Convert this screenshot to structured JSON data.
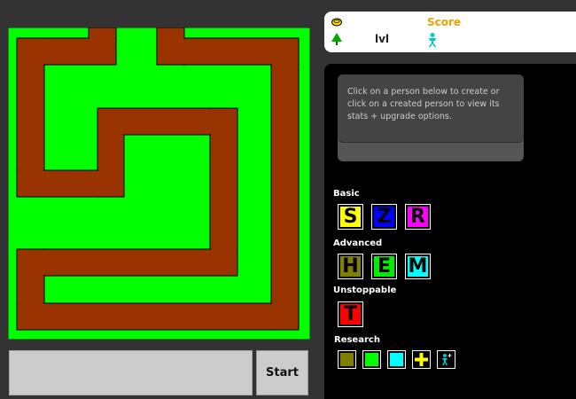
{
  "stats": {
    "score_label": "Score",
    "level_label": "lvl",
    "gold_icon": "coin-icon",
    "tree_icon": "tree-icon",
    "lives_icon": "person-icon"
  },
  "map": {
    "grass_color": "#00ff00",
    "path_color": "#993300"
  },
  "controls": {
    "start_label": "Start",
    "message": ""
  },
  "info": {
    "text": "Click on a person below to create or click on a created person to view its stats + upgrade options."
  },
  "sections": {
    "basic": "Basic",
    "advanced": "Advanced",
    "unstoppable": "Unstoppable",
    "research": "Research"
  },
  "units": {
    "basic": [
      {
        "letter": "S",
        "color": "#ffff00"
      },
      {
        "letter": "Z",
        "color": "#0000ff"
      },
      {
        "letter": "R",
        "color": "#ff00ff"
      }
    ],
    "advanced": [
      {
        "letter": "H",
        "color": "#808000"
      },
      {
        "letter": "E",
        "color": "#00ee00"
      },
      {
        "letter": "M",
        "color": "#00ffff"
      }
    ],
    "unstoppable": [
      {
        "letter": "T",
        "color": "#ff0000"
      }
    ]
  },
  "research": [
    {
      "name": "olive-research",
      "color": "#808000"
    },
    {
      "name": "green-research",
      "color": "#00ff00"
    },
    {
      "name": "cyan-research",
      "color": "#00ffff"
    },
    {
      "name": "plus-research",
      "color": "#ffff00"
    },
    {
      "name": "person-research",
      "color": "#00cccc"
    }
  ]
}
